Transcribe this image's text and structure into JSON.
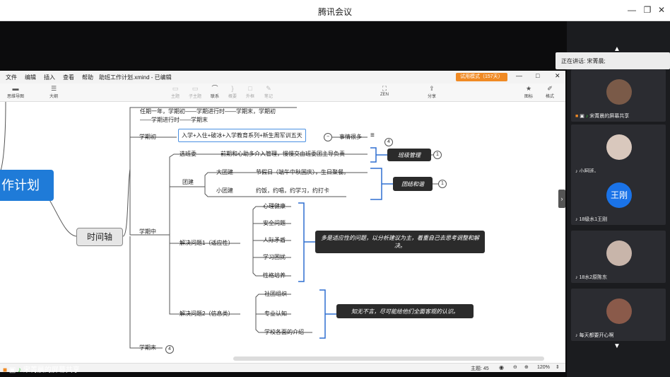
{
  "window": {
    "title": "腾讯会议"
  },
  "app": {
    "menu": [
      "文件",
      "编辑",
      "插入",
      "查看",
      "帮助"
    ],
    "document_title": "助班工作计划.xmind - 已编辑",
    "trial_badge": "试用模式（157天）",
    "toolbar": {
      "outline_view": "思维导图",
      "outline": "大纲",
      "topic": "主题",
      "subtopic": "子主题",
      "relation": "联系",
      "summary": "概要",
      "boundary": "外框",
      "note": "笔记",
      "zen": "ZEN",
      "share": "分享",
      "icon": "图标",
      "format": "格式"
    },
    "status": {
      "topics": "主题: 45",
      "zoom": "120%"
    }
  },
  "mindmap": {
    "root_partial": "作计划",
    "timeline": "时间轴",
    "intro_line1": "任期一年，学期初——学期进行时——学期末，学期初",
    "intro_line2": "——学期进行时——学期末",
    "term_start": "学期初",
    "term_start_detail": "入学+入住+破冰+入学教育系列+新生周军训五天",
    "many_things": "事情很多",
    "term_mid": "学期中",
    "term_end": "学期末",
    "badge_4": "4",
    "badge_1": "1",
    "class_committee": "选班委",
    "class_committee_detail": "前期和心助多介入管理，慢慢交由班委团主导负责",
    "class_management": "班级管理",
    "team_building": "团建",
    "big_team": "大团建",
    "big_team_detail": "节假日（端午中秋国庆），生日聚餐。",
    "small_team": "小团建",
    "small_team_detail": "约饭，约唱，约学习，约打卡",
    "unity": "团结和谐",
    "problem1": "解决问题1（适应性）",
    "problem1_items": [
      "心理健康",
      "安全问题",
      "人际矛盾",
      "学习困扰",
      "性格培养"
    ],
    "problem1_note": "多是适应性的问题，以分析建议为主，着重自己去思考调整和解决。",
    "problem2": "解决问题2（信息类）",
    "problem2_items": [
      "社团组织",
      "专业认知",
      "学校各面的介绍"
    ],
    "problem2_note": "知无不言，尽可能给他们全面客观的认识。"
  },
  "meeting": {
    "speaking": "正在讲话: 宋菁晨;",
    "screen_share_label": "宋菁晨的屏幕共享",
    "participants": [
      {
        "name": "宋菁晨的屏幕共享"
      },
      {
        "name": "小阿班。"
      },
      {
        "name": "18级水1王刚",
        "avatar_text": "王刚"
      },
      {
        "name": "18水2原陈东"
      },
      {
        "name": "每天都要开心啊"
      }
    ]
  }
}
